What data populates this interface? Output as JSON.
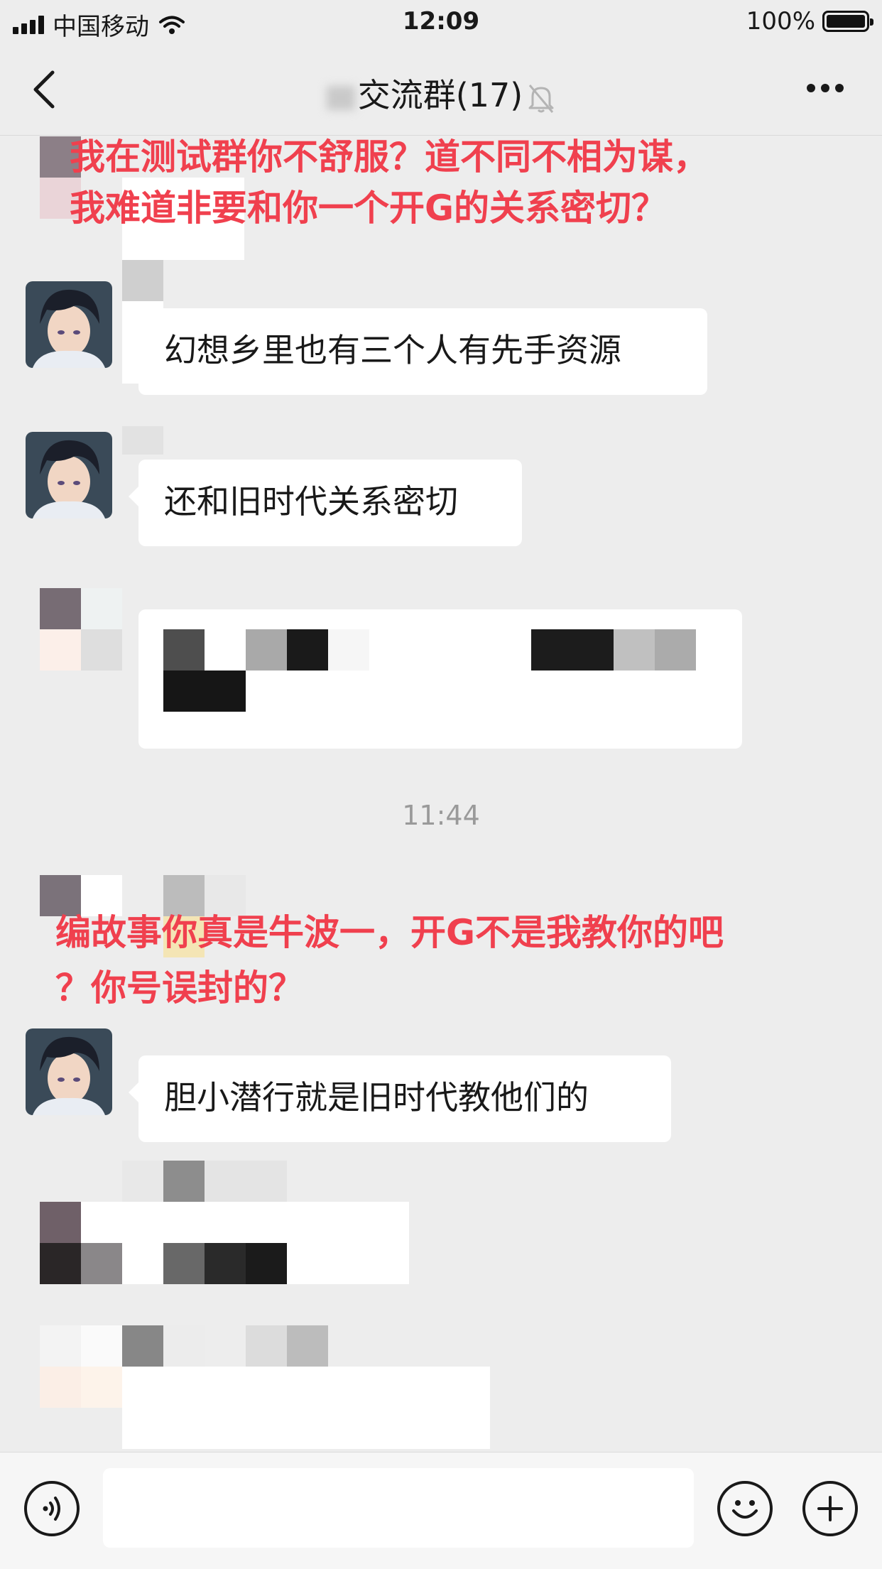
{
  "status_bar": {
    "carrier": "中国移动",
    "time": "12:09",
    "battery": "100%"
  },
  "nav": {
    "title": "交流群(17)"
  },
  "overlays": {
    "note1_line1": "我在测试群你不舒服？道不同不相为谋，",
    "note1_line2": "我难道非要和你一个开G的关系密切？",
    "note2_line1": "编故事你真是牛波一，开G不是我教你的吧",
    "note2_line2": "？你号误封的？"
  },
  "messages": [
    {
      "text": "幻想乡里也有三个人有先手资源"
    },
    {
      "text": "还和旧时代关系密切"
    },
    {
      "text": "胆小潜行就是旧时代教他们的"
    }
  ],
  "timestamp": "11:44",
  "input": {
    "value": ""
  },
  "icons": {
    "back": "chevron-left-icon",
    "mute": "bell-off-icon",
    "more": "more-icon",
    "voice": "voice-icon",
    "emoji": "emoji-icon",
    "add": "plus-circle-icon"
  }
}
